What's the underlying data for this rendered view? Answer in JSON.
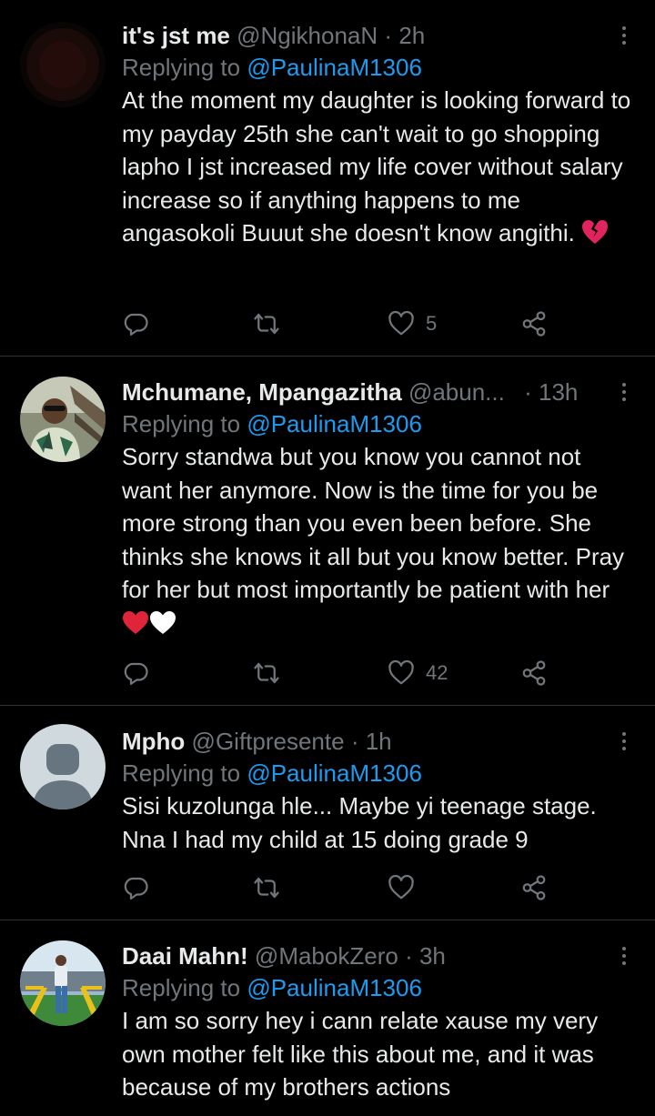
{
  "tweets": [
    {
      "name": "it's jst me",
      "handle": "@NgikhonaN",
      "dot": "·",
      "time": "2h",
      "replying_prefix": "Replying to ",
      "replying_to": "@PaulinaM1306",
      "text": "At the moment my daughter is looking forward to my payday 25th she can't wait to go shopping lapho I jst increased my life cover without salary increase so if anything happens to me angasokoli Buuut she doesn't know angithi.",
      "likes": "5"
    },
    {
      "name": "Mchumane, Mpangazitha",
      "handle": "@abun...",
      "dot": "·",
      "time": "13h",
      "replying_prefix": "Replying to ",
      "replying_to": "@PaulinaM1306",
      "text": "Sorry standwa but you know you cannot not want her anymore. Now is the time for you be more strong than you even been before. She thinks she knows it all but you know better. Pray for her but most importantly be patient with her",
      "likes": "42"
    },
    {
      "name": "Mpho",
      "handle": "@Giftpresente",
      "dot": "·",
      "time": "1h",
      "replying_prefix": "Replying to ",
      "replying_to": "@PaulinaM1306",
      "text": "Sisi kuzolunga hle... Maybe yi teenage stage. Nna I had my child at 15 doing grade 9",
      "likes": ""
    },
    {
      "name": "Daai Mahn!",
      "handle": "@MabokZero",
      "dot": "·",
      "time": "3h",
      "replying_prefix": "Replying to ",
      "replying_to": "@PaulinaM1306",
      "text": "I am so sorry hey i cann relate xause my very own mother felt like this about me, and it was because of my brothers actions",
      "likes": ""
    }
  ],
  "icons": {
    "reply": "reply-icon",
    "retweet": "retweet-icon",
    "like": "heart-icon",
    "share": "share-icon",
    "more": "more-icon",
    "broken_heart": "broken-heart-emoji",
    "red_heart": "red-heart-emoji",
    "white_heart": "white-heart-emoji"
  },
  "colors": {
    "background": "#000000",
    "text": "#e7e9ea",
    "secondary": "#71767b",
    "accent": "#1d9bf0",
    "divider": "#2f3336",
    "heart_red": "#e0245e"
  }
}
